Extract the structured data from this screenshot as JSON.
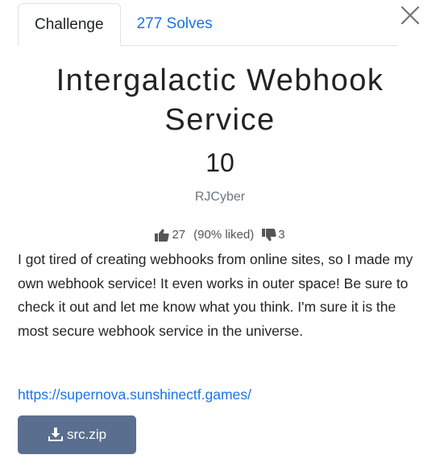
{
  "tabs": [
    {
      "label": "Challenge",
      "active": true
    },
    {
      "label": "277 Solves",
      "active": false
    }
  ],
  "close_icon": "close-icon",
  "challenge": {
    "title": "Intergalactic Webhook Service",
    "points": "10",
    "author": "RJCyber"
  },
  "rating": {
    "likes": "27",
    "liked_percent": "(90% liked)",
    "dislikes": "3",
    "like_icon": "thumbs-up-icon",
    "dislike_icon": "thumbs-down-icon"
  },
  "description": "I got tired of creating webhooks from online sites, so I made my own webhook service! It even works in outer space! Be sure to check it out and let me know what you think. I'm sure it is the most secure webhook service in the universe.",
  "link": "https://supernova.sunshinectf.games/",
  "download": {
    "label": "src.zip",
    "icon": "download-icon"
  },
  "colors": {
    "link": "#1a73e8",
    "button": "#5a6f8f"
  }
}
